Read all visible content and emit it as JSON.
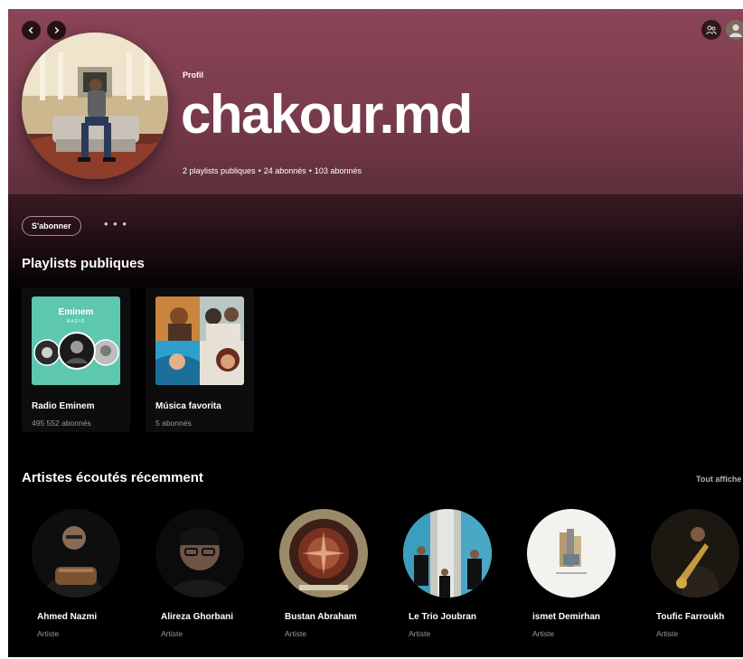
{
  "nav": {
    "back_icon": "chevron-left-icon",
    "forward_icon": "chevron-right-icon"
  },
  "top_right": {
    "friends_icon": "friend-activity-icon",
    "user_icon": "user-avatar-icon"
  },
  "profile": {
    "kicker": "Profil",
    "name": "chakour.md",
    "playlists": "2 playlists publiques",
    "followers": "24 abonnés",
    "following": "103 abonnés",
    "separator": "•"
  },
  "actions": {
    "follow_label": "S'abonner",
    "more_label": "• • •"
  },
  "playlists_section": {
    "title": "Playlists publiques",
    "items": [
      {
        "title": "Radio Eminem",
        "subtitle": "495 552 abonnés",
        "cover_text": "Eminem",
        "cover_sub": "RADIO"
      },
      {
        "title": "Música favorita",
        "subtitle": "5 abonnés"
      }
    ]
  },
  "artists_section": {
    "title": "Artistes écoutés récemment",
    "show_all": "Tout affiche",
    "items": [
      {
        "name": "Ahmed Nazmi",
        "role": "Artiste"
      },
      {
        "name": "Alireza Ghorbani",
        "role": "Artiste"
      },
      {
        "name": "Bustan Abraham",
        "role": "Artiste"
      },
      {
        "name": "Le Trio Joubran",
        "role": "Artiste"
      },
      {
        "name": "ismet Demirhan",
        "role": "Artiste"
      },
      {
        "name": "Toufic Farroukh",
        "role": "Artiste"
      }
    ]
  },
  "colors": {
    "header": "#8a4556",
    "background": "#000000",
    "card": "#0d0d0d",
    "muted_text": "#9a9a9a"
  }
}
